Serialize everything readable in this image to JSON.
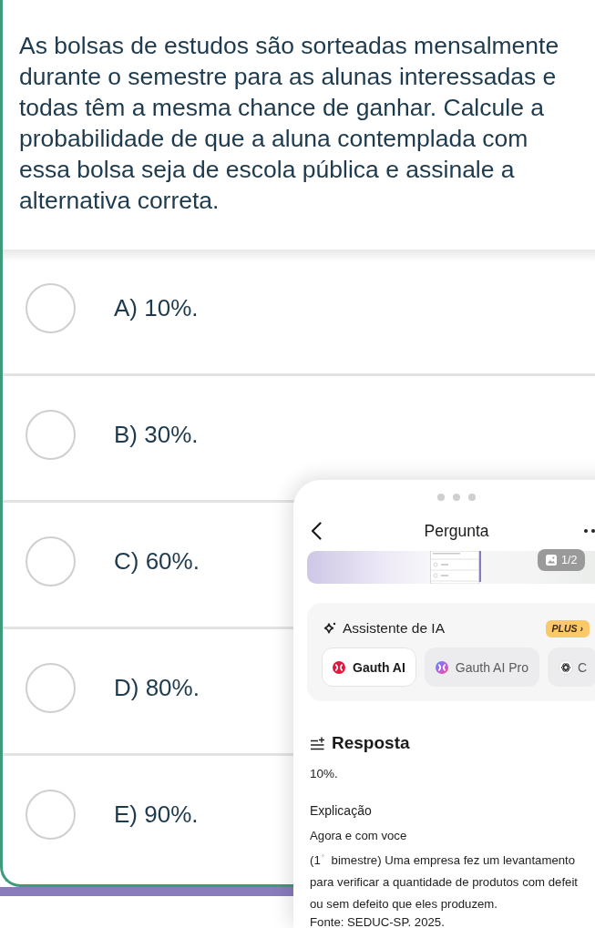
{
  "question": {
    "text": "As bolsas de estudos são sorteadas mensalmente durante o semestre para as alunas interessadas e todas têm a mesma chance de ganhar. Calcule a probabilidade de que a aluna contemplada com essa bolsa seja de escola pública e assinale a alternativa correta."
  },
  "options": [
    {
      "label": "A) 10%.",
      "selected": false
    },
    {
      "label": "B) 30%.",
      "selected": false
    },
    {
      "label": "C) 60%.",
      "selected": false
    },
    {
      "label": "D) 80%.",
      "selected": false
    },
    {
      "label": "E) 90%.",
      "selected": false
    }
  ],
  "answer_panel": {
    "title": "Pergunta",
    "image_counter": "1/2",
    "assistant": {
      "title": "Assistente de IA",
      "badge": "PLUS ›",
      "models": [
        {
          "kind": "gauth",
          "label": "Gauth AI",
          "selected": true
        },
        {
          "kind": "gauth-pro",
          "label": "Gauth AI Pro",
          "selected": false
        },
        {
          "kind": "other",
          "label": "C",
          "selected": false
        }
      ]
    },
    "answer": {
      "heading": "Resposta",
      "value": "10%.",
      "explanation_heading": "Explicação",
      "explanation_lines": [
        "Agora e com voce",
        "(1$^{°}$ bimestre) Uma empresa fez um levantamento",
        "para verificar a quantidade de produtos com defeit",
        "ou sem defeito que eles produzem.",
        "Fonte: SEDUC-SP. 2025."
      ]
    }
  }
}
